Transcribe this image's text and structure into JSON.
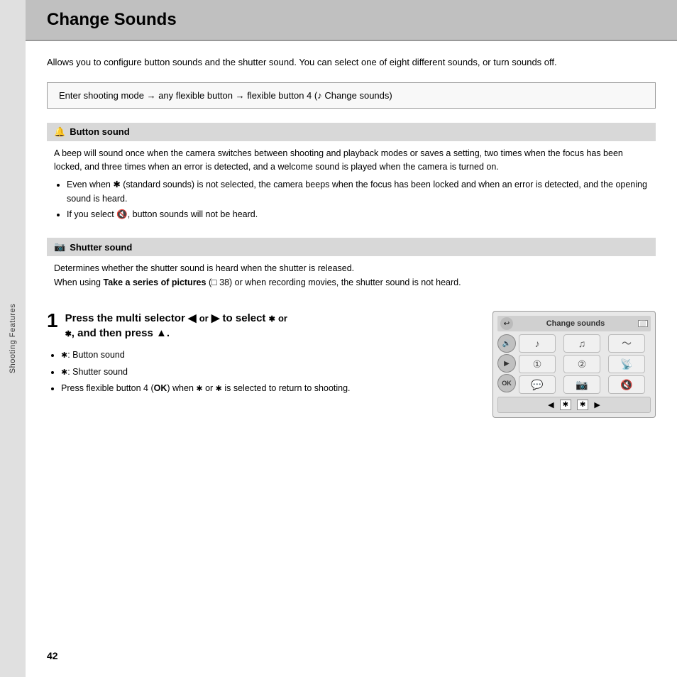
{
  "title": "Change Sounds",
  "sidebar_label": "Shooting Features",
  "intro": "Allows you to configure button sounds and the shutter sound. You can select one of eight different sounds, or turn sounds off.",
  "nav_box": "Enter shooting mode → any flexible button → flexible button 4 (♪ Change sounds)",
  "sections": [
    {
      "id": "button-sound",
      "icon": "🔔",
      "header": "Button sound",
      "body": "A beep will sound once when the camera switches between shooting and playback modes or saves a setting, two times when the focus has been locked, and three times when an error is detected, and a welcome sound is played when the camera is turned on.",
      "bullets": [
        "Even when ✱ (standard sounds) is not selected, the camera beeps when the focus has been locked and when an error is detected, and the opening sound is heard.",
        "If you select 🔇, button sounds will not be heard."
      ]
    },
    {
      "id": "shutter-sound",
      "icon": "📷",
      "header": "Shutter sound",
      "body": "Determines whether the shutter sound is heard when the shutter is released.\nWhen using Take a series of pictures (□ 38) or when recording movies, the shutter sound is not heard.",
      "body_bold": "Take a series of pictures"
    }
  ],
  "step": {
    "number": "1",
    "title": "Press the multi selector ◀ or ▶ to select ✱ or ✱, and then press ▲.",
    "bullets": [
      "✱: Button sound",
      "✱: Shutter sound",
      "Press flexible button 4 (OK) when ✱ or ✱ is selected to return to shooting."
    ]
  },
  "camera_ui": {
    "header": "Change sounds",
    "icons": [
      "♪",
      "♫",
      "〜",
      "①",
      "②",
      "📡",
      "💬",
      "📷",
      "🔇"
    ],
    "bottom_left": "◀",
    "bottom_mid1": "✱",
    "bottom_mid2": "✱",
    "bottom_right": "▶"
  },
  "page_number": "42",
  "colors": {
    "title_bg": "#c0c0c0",
    "section_header_bg": "#d8d8d8",
    "sidebar_bg": "#e0e0e0",
    "nav_box_border": "#999999"
  }
}
